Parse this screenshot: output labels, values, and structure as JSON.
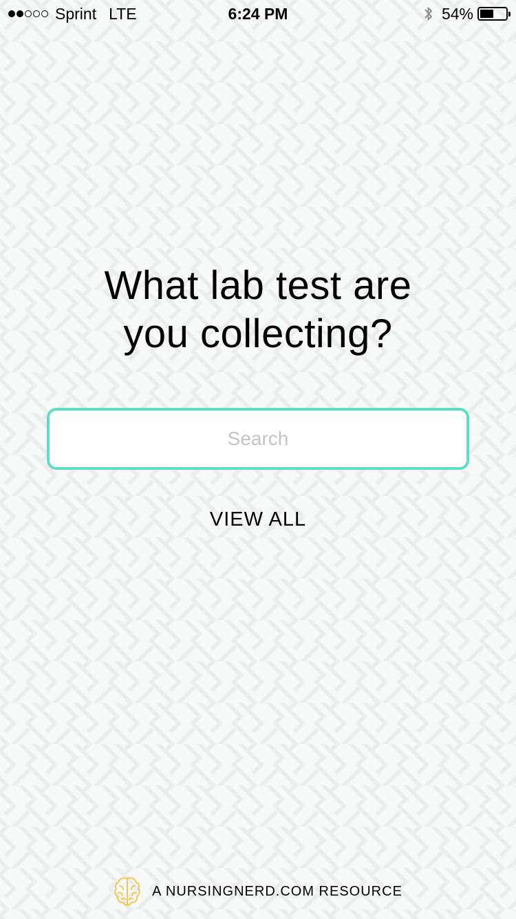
{
  "status_bar": {
    "signal_bars_filled": 2,
    "signal_bars_total": 5,
    "carrier": "Sprint",
    "network": "LTE",
    "time": "6:24 PM",
    "bluetooth_icon": "bluetooth-icon",
    "battery_percent": "54%",
    "battery_level": 0.54
  },
  "main": {
    "headline_line1": "What lab test are",
    "headline_line2": "you collecting?",
    "search": {
      "placeholder": "Search",
      "value": ""
    },
    "view_all_label": "VIEW ALL"
  },
  "footer": {
    "icon": "brain-icon",
    "text": "A NURSINGNERD.COM RESOURCE"
  },
  "colors": {
    "accent": "#5ddfc4",
    "footer_icon": "#f2c94c",
    "background": "#f7f8f8"
  }
}
